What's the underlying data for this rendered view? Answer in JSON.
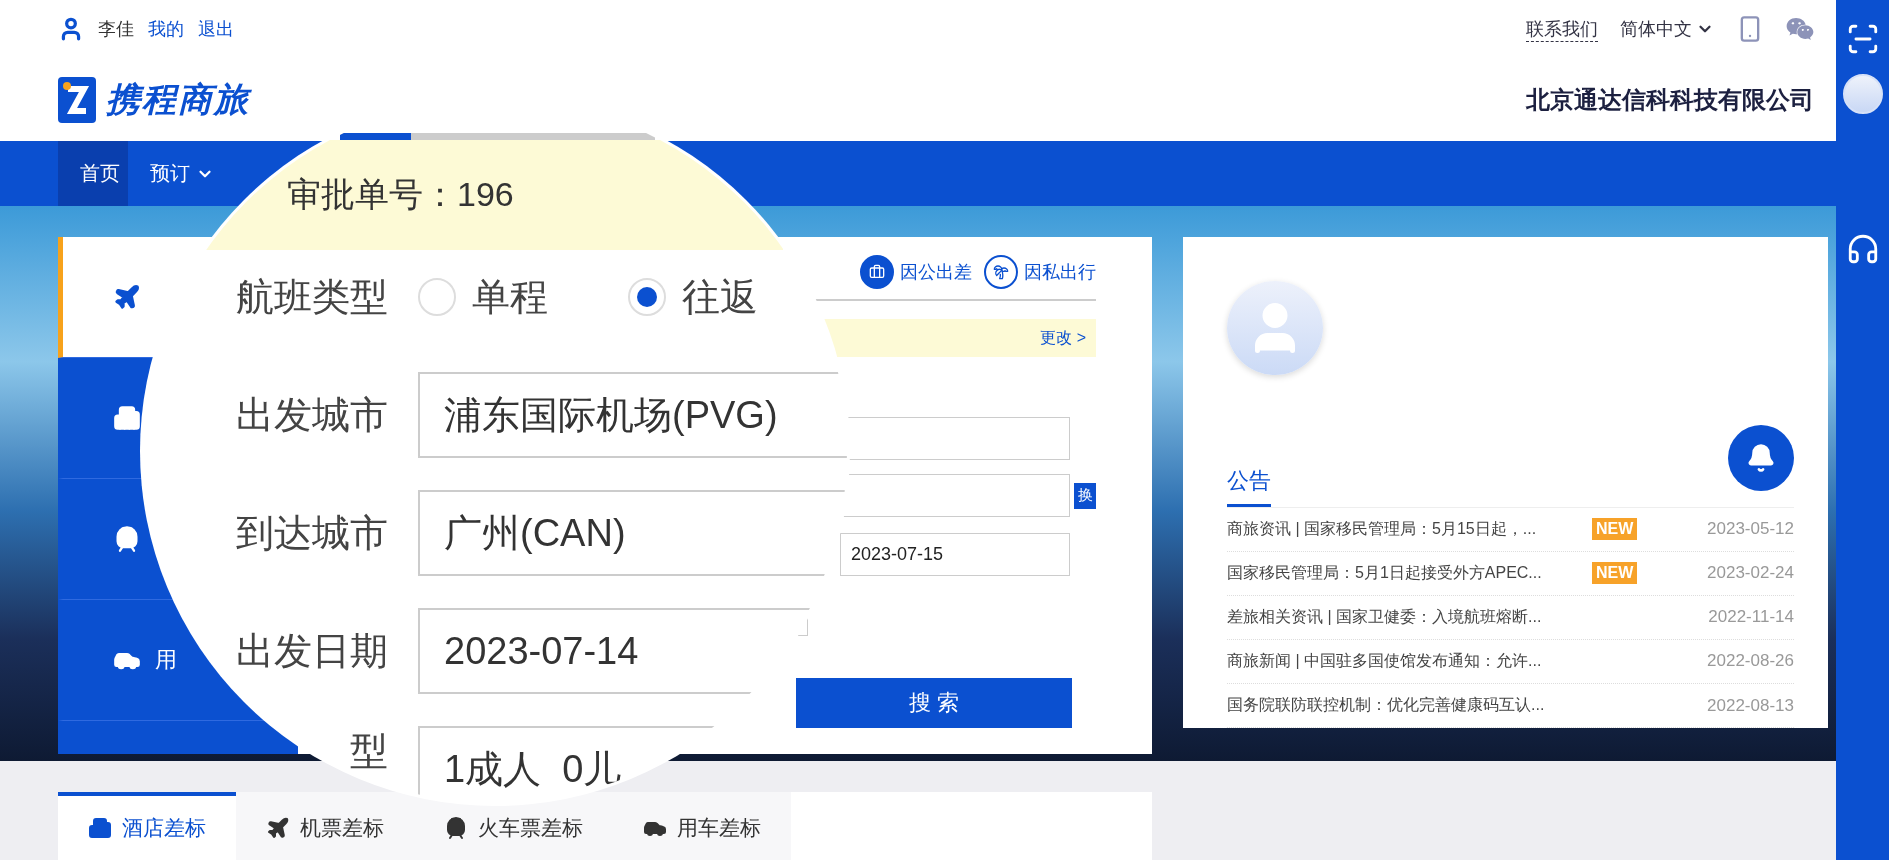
{
  "user_bar": {
    "user_name": "李佳",
    "links": [
      "我的",
      "退出"
    ]
  },
  "top_right": {
    "contact": "联系我们",
    "language": "简体中文"
  },
  "brand": {
    "name": "携程商旅",
    "company": "北京通达信科科技有限公司"
  },
  "nav": [
    {
      "label": "首页",
      "selected": true,
      "dropdown": false
    },
    {
      "label": "预订",
      "selected": false,
      "dropdown": true
    }
  ],
  "booking_card": {
    "side_tabs": [
      {
        "kind": "flight",
        "selected": true
      },
      {
        "kind": "hotel",
        "selected": false
      },
      {
        "kind": "train",
        "selected": false
      },
      {
        "kind": "car",
        "label": "用",
        "selected": false
      }
    ],
    "trip_types": [
      {
        "kind": "business",
        "label": "因公出差",
        "selected": true
      },
      {
        "kind": "private",
        "label": "因私出行",
        "selected": false
      }
    ],
    "change_link": "更改 >",
    "swap_button": "换",
    "return_date": "2023-07-15",
    "search_button": "搜 索"
  },
  "magnifier": {
    "approval": "审批单号：196",
    "flight_type_label": "航班类型",
    "flight_types": [
      {
        "label": "单程",
        "selected": false
      },
      {
        "label": "往返",
        "selected": true
      }
    ],
    "fields": [
      {
        "label": "出发城市",
        "value": "浦东国际机场(PVG)"
      },
      {
        "label": "到达城市",
        "value": "广州(CAN)"
      },
      {
        "label": "出发日期",
        "value": "2023-07-14"
      },
      {
        "label": "型",
        "value": "1成人  0儿"
      }
    ]
  },
  "announcements": {
    "tab": "公告",
    "items": [
      {
        "title": "商旅资讯 | 国家移民管理局：5月15日起，...",
        "is_new": true,
        "badge": "NEW",
        "date": "2023-05-12"
      },
      {
        "title": "国家移民管理局：5月1日起接受外方APEC...",
        "is_new": true,
        "badge": "NEW",
        "date": "2023-02-24"
      },
      {
        "title": "差旅相关资讯 | 国家卫健委：入境航班熔断...",
        "is_new": false,
        "date": "2022-11-14"
      },
      {
        "title": "商旅新闻 | 中国驻多国使馆发布通知：允许...",
        "is_new": false,
        "date": "2022-08-26"
      },
      {
        "title": "国务院联防联控机制：优化完善健康码互认...",
        "is_new": false,
        "date": "2022-08-13"
      }
    ]
  },
  "standard_tabs": [
    {
      "kind": "hotel",
      "label": "酒店差标",
      "selected": true
    },
    {
      "kind": "flight",
      "label": "机票差标",
      "selected": false
    },
    {
      "kind": "train",
      "label": "火车票差标",
      "selected": false
    },
    {
      "kind": "car",
      "label": "用车差标",
      "selected": false
    }
  ]
}
